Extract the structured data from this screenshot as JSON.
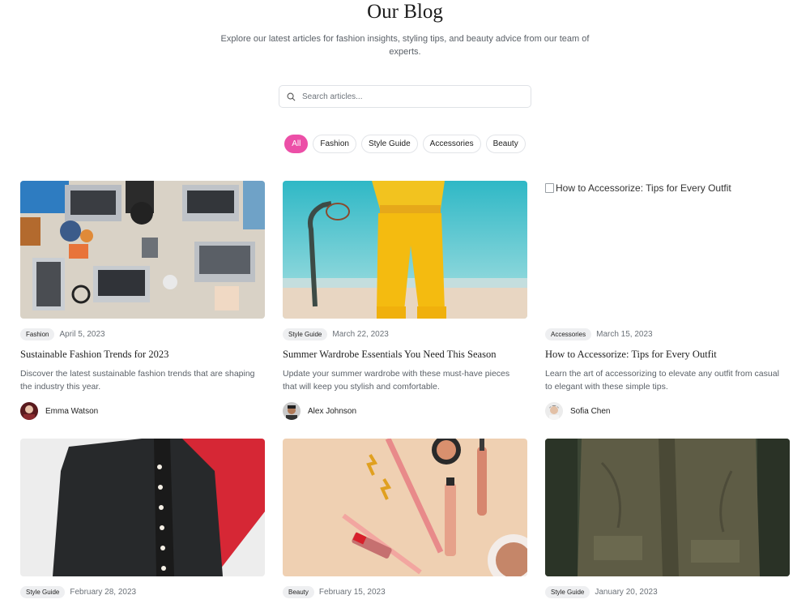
{
  "header": {
    "title": "Our Blog",
    "subtitle": "Explore our latest articles for fashion insights, styling tips, and beauty advice from our team of experts."
  },
  "search": {
    "placeholder": "Search articles...",
    "value": "",
    "icon": "search-icon"
  },
  "filters": [
    {
      "label": "All",
      "active": true
    },
    {
      "label": "Fashion",
      "active": false
    },
    {
      "label": "Style Guide",
      "active": false
    },
    {
      "label": "Accessories",
      "active": false
    },
    {
      "label": "Beauty",
      "active": false
    }
  ],
  "accent_color": "#ec4fa7",
  "posts": [
    {
      "category": "Fashion",
      "date": "April 5, 2023",
      "title": "Sustainable Fashion Trends for 2023",
      "excerpt": "Discover the latest sustainable fashion trends that are shaping the industry this year.",
      "author": "Emma Watson",
      "image": "desk-laptops-photo"
    },
    {
      "category": "Style Guide",
      "date": "March 22, 2023",
      "title": "Summer Wardrobe Essentials You Need This Season",
      "excerpt": "Update your summer wardrobe with these must-have pieces that will keep you stylish and comfortable.",
      "author": "Alex Johnson",
      "image": "yellow-tracksuit-photo"
    },
    {
      "category": "Accessories",
      "date": "March 15, 2023",
      "title": "How to Accessorize: Tips for Every Outfit",
      "excerpt": "Learn the art of accessorizing to elevate any outfit from casual to elegant with these simple tips.",
      "author": "Sofia Chen",
      "image": "broken-image",
      "image_alt": "How to Accessorize: Tips for Every Outfit"
    },
    {
      "category": "Style Guide",
      "date": "February 28, 2023",
      "image": "black-ruffle-jacket-photo"
    },
    {
      "category": "Beauty",
      "date": "February 15, 2023",
      "image": "makeup-flatlay-photo"
    },
    {
      "category": "Style Guide",
      "date": "January 20, 2023",
      "image": "olive-jacket-photo"
    }
  ]
}
